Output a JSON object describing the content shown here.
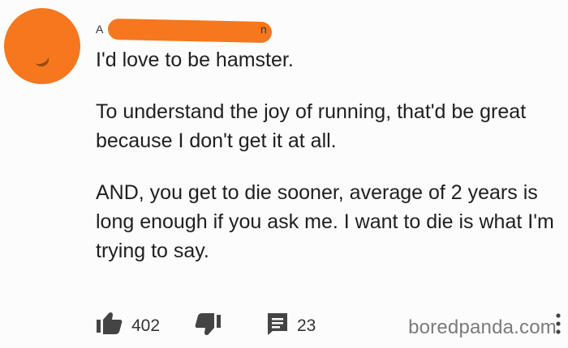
{
  "comment": {
    "author_fragment_left": "A",
    "author_fragment_right": "n",
    "paragraphs": [
      "I'd love to be hamster.",
      "To understand the joy of running, that'd be great because I don't get it at all.",
      "AND, you get to die sooner, average of 2 years is long enough if you ask me. I want to die is what I'm trying to say."
    ],
    "likes": "402",
    "replies": "23"
  },
  "icons": {
    "like": "thumbs-up-icon",
    "dislike": "thumbs-down-icon",
    "reply": "comment-icon",
    "more": "more-vertical-icon"
  },
  "colors": {
    "avatar": "#f6771e",
    "redaction": "#f6771e",
    "background": "#fcfcfc",
    "text": "#1f1f1f"
  },
  "watermark": "boredpanda.com"
}
